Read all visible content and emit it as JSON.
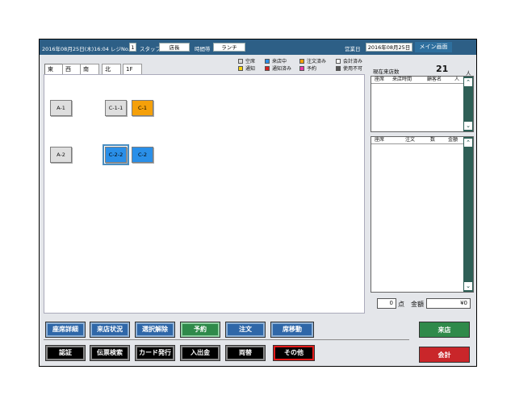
{
  "colors": {
    "topbar": "#2d5f86",
    "main_screen_button": "#2e6f9e",
    "arrive_button": "#2f8a4a",
    "checkout_button": "#c9262a",
    "seat_orange": "#f5a00a",
    "seat_blue": "#2a8fe8"
  },
  "header": {
    "datetime": "2016年08月25日(木)16:04",
    "register_label": "レジNo.",
    "register_no": "1",
    "staff_label": "スタッフ",
    "staff": "店長",
    "timezone_label": "時間帯",
    "timezone": "ランチ",
    "business_date_label": "営業日",
    "business_date": "2016年08月25日",
    "main_screen": "メイン画面"
  },
  "tabs": [
    {
      "label": "東"
    },
    {
      "label": "西"
    },
    {
      "label": "南"
    },
    {
      "label": "北"
    },
    {
      "label": "1F"
    }
  ],
  "legend": [
    {
      "label": "空席",
      "color": "#d8d8d8"
    },
    {
      "label": "来店中",
      "color": "#2a8fe8"
    },
    {
      "label": "注文済み",
      "color": "#f5a00a"
    },
    {
      "label": "会計済み",
      "color": "#ffffff"
    },
    {
      "label": "通知",
      "color": "#f5d20a"
    },
    {
      "label": "通知済み",
      "color": "#d81e1e"
    },
    {
      "label": "予約",
      "color": "#e83aa8"
    },
    {
      "label": "使用不可",
      "color": "#555555"
    }
  ],
  "seats": [
    {
      "label": "A-1",
      "state": "empty"
    },
    {
      "label": "C-1-1",
      "state": "empty"
    },
    {
      "label": "C-1",
      "state": "ordered"
    },
    {
      "label": "A-2",
      "state": "empty"
    },
    {
      "label": "C-2-2",
      "state": "visiting-selected"
    },
    {
      "label": "C-2",
      "state": "visiting"
    }
  ],
  "right": {
    "current_visitors_label": "現在来店数",
    "current_visitors": "21",
    "person_unit": "人",
    "visit_table": {
      "columns": [
        "座席",
        "来店時間",
        "顧客名",
        "人"
      ]
    },
    "order_table": {
      "columns": [
        "座席",
        "注文",
        "数",
        "金額"
      ]
    },
    "count": "0",
    "count_unit": "点",
    "amount_label": "金額",
    "amount": "¥0"
  },
  "buttons_row1": [
    {
      "label": "座席詳細",
      "style": "blue"
    },
    {
      "label": "来店状況",
      "style": "blue"
    },
    {
      "label": "選択解除",
      "style": "blue"
    },
    {
      "label": "予約",
      "style": "green"
    },
    {
      "label": "注文",
      "style": "blue"
    },
    {
      "label": "席移動",
      "style": "blue"
    }
  ],
  "buttons_row2": [
    {
      "label": "認証",
      "style": "black"
    },
    {
      "label": "伝票検索",
      "style": "black"
    },
    {
      "label": "カード発行",
      "style": "black"
    },
    {
      "label": "入出金",
      "style": "black"
    },
    {
      "label": "両替",
      "style": "black"
    },
    {
      "label": "その他",
      "style": "red"
    }
  ],
  "side_buttons": {
    "arrive": "来店",
    "checkout": "会計"
  },
  "icons": {
    "scroll_up": "up-double-chevron-icon",
    "scroll_down": "down-double-chevron-icon"
  }
}
